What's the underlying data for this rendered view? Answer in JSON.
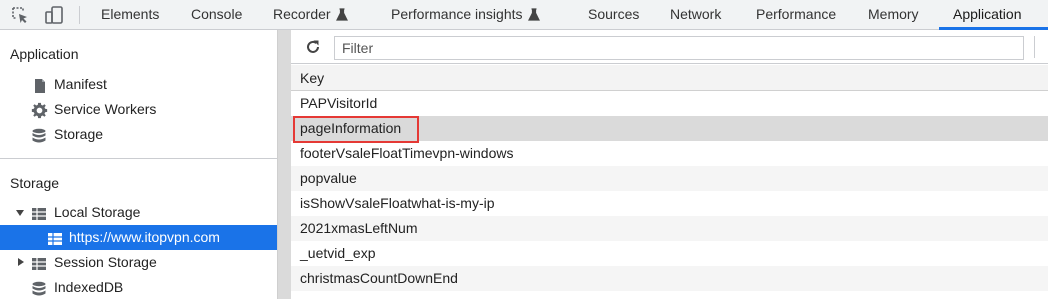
{
  "toolbar_icons": {
    "inspect": "inspect-element-icon",
    "device": "device-toolbar-icon"
  },
  "tabs": [
    {
      "label": "Elements"
    },
    {
      "label": "Console"
    },
    {
      "label": "Recorder",
      "icon": "flask-icon"
    },
    {
      "label": "Performance insights",
      "icon": "flask-icon"
    },
    {
      "label": "Sources"
    },
    {
      "label": "Network"
    },
    {
      "label": "Performance"
    },
    {
      "label": "Memory"
    },
    {
      "label": "Application",
      "active": true
    }
  ],
  "sidebar": {
    "application_section": {
      "title": "Application",
      "items": [
        {
          "label": "Manifest",
          "icon": "file-icon"
        },
        {
          "label": "Service Workers",
          "icon": "gear-icon"
        },
        {
          "label": "Storage",
          "icon": "database-icon"
        }
      ]
    },
    "storage_section": {
      "title": "Storage",
      "local_storage": {
        "label": "Local Storage",
        "expanded": true
      },
      "local_storage_origin": {
        "label": "https://www.itopvpn.com",
        "selected": true
      },
      "session_storage": {
        "label": "Session Storage",
        "expanded": false
      },
      "indexeddb": {
        "label": "IndexedDB"
      }
    }
  },
  "main": {
    "filter": {
      "placeholder": "Filter",
      "value": ""
    },
    "column_header": "Key",
    "rows": [
      "PAPVisitorId",
      "pageInformation",
      "footerVsaleFloatTimevpn-windows",
      "popvalue",
      "isShowVsaleFloatwhat-is-my-ip",
      "2021xmasLeftNum",
      "_uetvid_exp",
      "christmasCountDownEnd"
    ],
    "selected_row_index": 1
  },
  "colors": {
    "accent": "#1a73e8",
    "highlight_box": "#e53935"
  }
}
